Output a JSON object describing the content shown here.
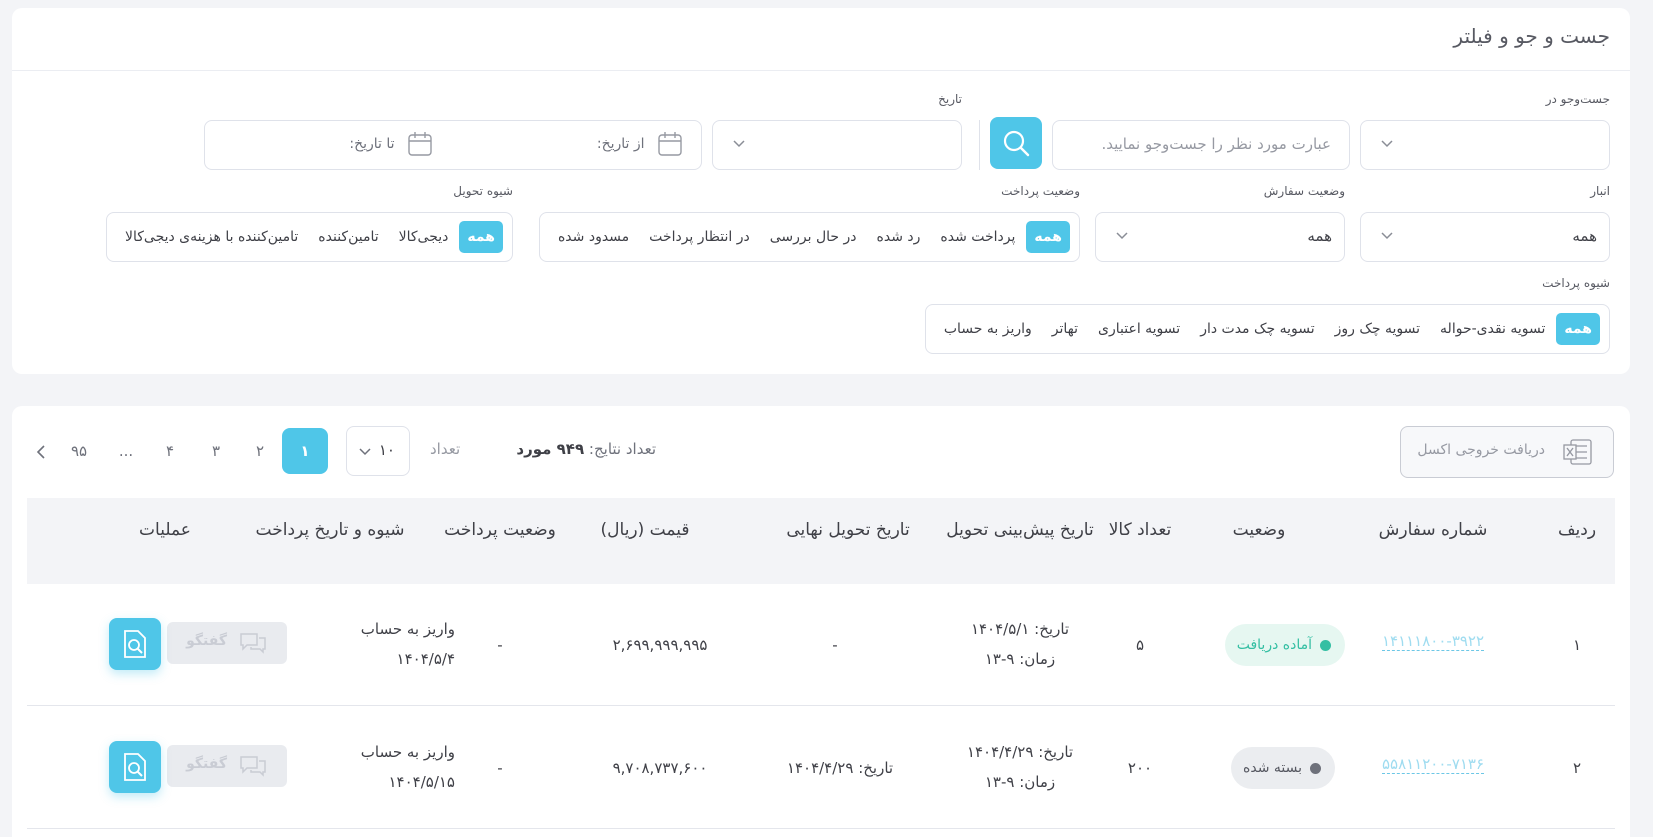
{
  "filter": {
    "title": "جست و جو و فیلتر",
    "search_in_label": "جست‌وجو در",
    "search_placeholder": "عبارت مورد نظر را جست‌وجو نمایید.",
    "date_label": "تاریخ",
    "from_date": "از تاریخ:",
    "to_date": "تا تاریخ:",
    "warehouse_label": "انبار",
    "warehouse_value": "همه",
    "order_status_label": "وضعیت سفارش",
    "order_status_value": "همه",
    "payment_status_label": "وضعیت پرداخت",
    "payment_status_options": [
      "همه",
      "پرداخت شده",
      "رد شده",
      "در حال بررسی",
      "در انتظار پرداخت",
      "مسدود شده"
    ],
    "delivery_method_label": "شیوه تحویل",
    "delivery_method_options": [
      "همه",
      "دیجی‌کالا",
      "تامین‌کننده",
      "تامین‌کننده با هزینه‌ی دیجی‌کالا"
    ],
    "payment_method_label": "شیوه پرداخت",
    "payment_method_options": [
      "همه",
      "تسویه نقدی-حواله",
      "تسویه چک روز",
      "تسویه چک مدت دار",
      "تسویه اعتباری",
      "تهاتر",
      "واریز به حساب"
    ]
  },
  "results": {
    "excel_button": "دریافت خروجی اکسل",
    "count_label": "تعداد نتایج:",
    "count_value": "۹۴۹ مورد",
    "per_page_label": "تعداد",
    "per_page_value": "۱۰",
    "pages": [
      "۱",
      "۲",
      "۳",
      "۴",
      "...",
      "۹۵"
    ],
    "active_page": "۱",
    "columns": [
      "ردیف",
      "شماره سفارش",
      "وضعیت",
      "تعداد کالا",
      "تاریخ پیش‌بینی تحویل",
      "تاریخ تحویل نهایی",
      "قیمت (ریال)",
      "وضعیت پرداخت",
      "شیوه و تاریخ پرداخت",
      "عملیات"
    ],
    "chat_label": "گفتگو",
    "rows": [
      {
        "index": "۱",
        "order_no": "۱۴۱۱۱۸۰۰-۳۹۲۲",
        "status": "آماده دریافت",
        "status_bg": "#e6f7f1",
        "status_dot": "#34bfa3",
        "status_color": "#34bfa3",
        "qty": "۵",
        "forecast_date": "تاریخ: ۱۴۰۴/۵/۱",
        "forecast_time": "زمان: ۹-۱۳",
        "final_delivery": "-",
        "price": "۲,۶۹۹,۹۹۹,۹۹۵",
        "payment_status": "-",
        "payment_method": "واریز به حساب",
        "payment_date": "۱۴۰۴/۵/۴"
      },
      {
        "index": "۲",
        "order_no": "۵۵۸۱۱۲۰۰-۷۱۳۶",
        "status": "بسته شده",
        "status_bg": "#ebedf0",
        "status_dot": "#6e717b",
        "status_color": "#575962",
        "qty": "۲۰۰",
        "forecast_date": "تاریخ: ۱۴۰۴/۴/۲۹",
        "forecast_time": "زمان: ۹-۱۳",
        "final_delivery": "تاریخ: ۱۴۰۴/۴/۲۹",
        "price": "۹,۷۰۸,۷۳۷,۶۰۰",
        "payment_status": "-",
        "payment_method": "واریز به حساب",
        "payment_date": "۱۴۰۴/۵/۱۵"
      }
    ]
  },
  "colors": {
    "accent": "#4fc6e8",
    "border": "#dfe2ea",
    "bg": "#f3f4f7"
  },
  "icons": [
    "search-icon",
    "chevron-down-icon",
    "calendar-icon",
    "excel-icon",
    "chevron-left-icon",
    "chat-icon",
    "view-document-icon"
  ]
}
